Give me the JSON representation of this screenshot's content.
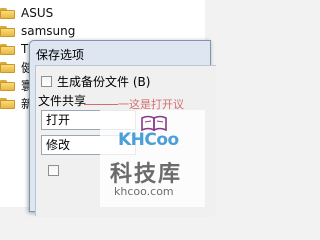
{
  "explorer": {
    "items": [
      {
        "label": "ASUS"
      },
      {
        "label": "samsung"
      },
      {
        "label": "T"
      },
      {
        "label": "健"
      },
      {
        "label": "寰"
      },
      {
        "label": "新"
      }
    ]
  },
  "dialog": {
    "title": "保存选项",
    "backup_checkbox": {
      "label": "生成备份文件 (B)",
      "checked": false
    },
    "file_sharing_label": "文件共享",
    "combo_open": "打开",
    "combo_modify": "修改",
    "readonly_checkbox": {
      "label": "",
      "checked": false
    }
  },
  "annotation": {
    "text": "一这是打开议"
  },
  "watermark": {
    "logo": "KHCoo",
    "cn": "科技库",
    "url": "khcoo.com"
  },
  "colors": {
    "folder": "#f2c94c",
    "dialog_frame": "#dde6f1",
    "watermark_blue": "#4a9fd8",
    "annotation_red": "#c00000"
  }
}
